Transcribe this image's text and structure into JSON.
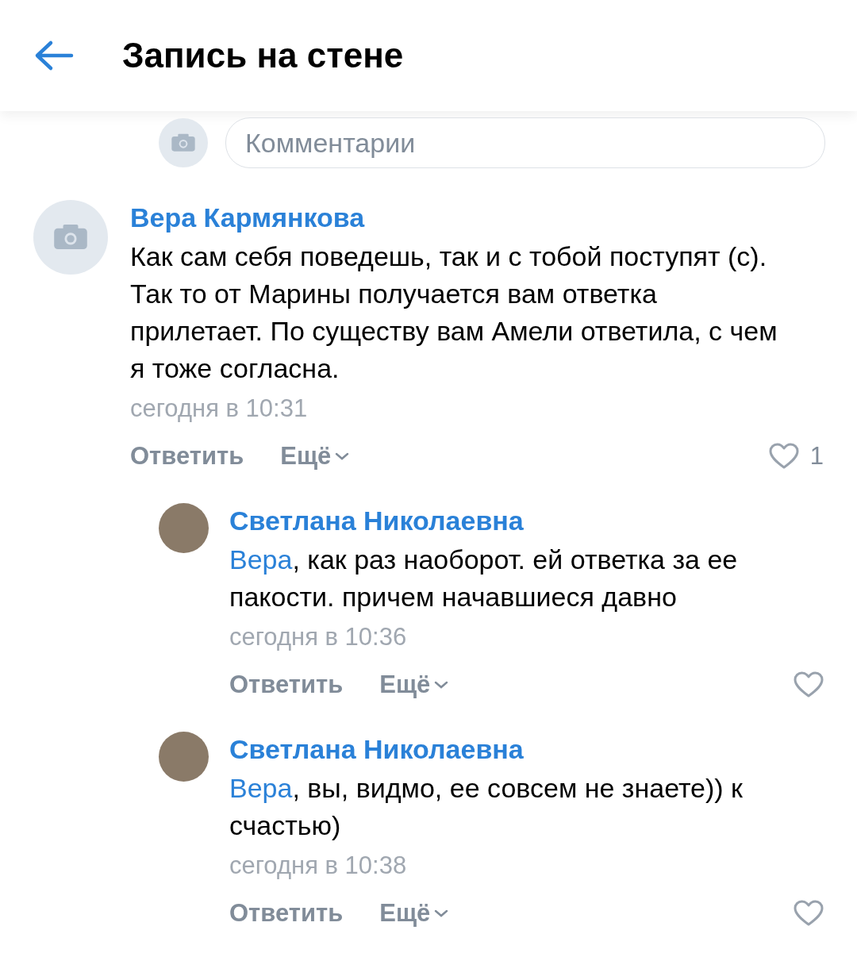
{
  "header": {
    "title": "Запись на стене"
  },
  "comment_field": {
    "placeholder": "Комментарии"
  },
  "comments": [
    {
      "kind": "camera",
      "author": "Вера Кармянкова",
      "text": "Как сам себя поведешь, так и с тобой поступят (с). Так то от Марины получается вам ответка прилетает. По существу вам Амели ответила, с чем я тоже согласна.",
      "time": "сегодня в 10:31",
      "reply": "Ответить",
      "more": "Ещё",
      "likes": "1",
      "children": [
        {
          "kind": "photo",
          "author": "Светлана Николаевна",
          "mention": "Вера",
          "text": ", как раз наоборот. ей ответка за ее пакости. причем начавшиеся давно",
          "time": "сегодня в 10:36",
          "reply": "Ответить",
          "more": "Ещё"
        },
        {
          "kind": "photo",
          "author": "Светлана Николаевна",
          "mention": "Вера",
          "text": ", вы, видмо, ее совсем не знаете)) к счастью)",
          "time": "сегодня в 10:38",
          "reply": "Ответить",
          "more": "Ещё"
        }
      ]
    }
  ]
}
